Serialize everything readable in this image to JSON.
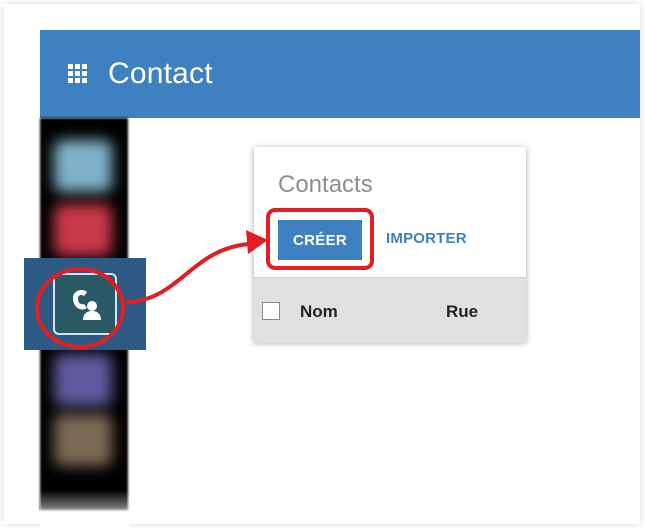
{
  "header": {
    "app_title": "Contact",
    "icon": "apps-grid-icon",
    "color": "#3f80c1"
  },
  "dock": {
    "items": [
      "app-tile",
      "app-tile",
      "contact-app-tile",
      "app-tile",
      "app-tile"
    ],
    "highlighted_icon": "contact-phone-icon"
  },
  "card": {
    "title": "Contacts",
    "create_label": "CRÉER",
    "import_label": "IMPORTER",
    "columns": [
      "Nom",
      "Rue"
    ]
  },
  "annotation": {
    "color": "#e01e23"
  }
}
